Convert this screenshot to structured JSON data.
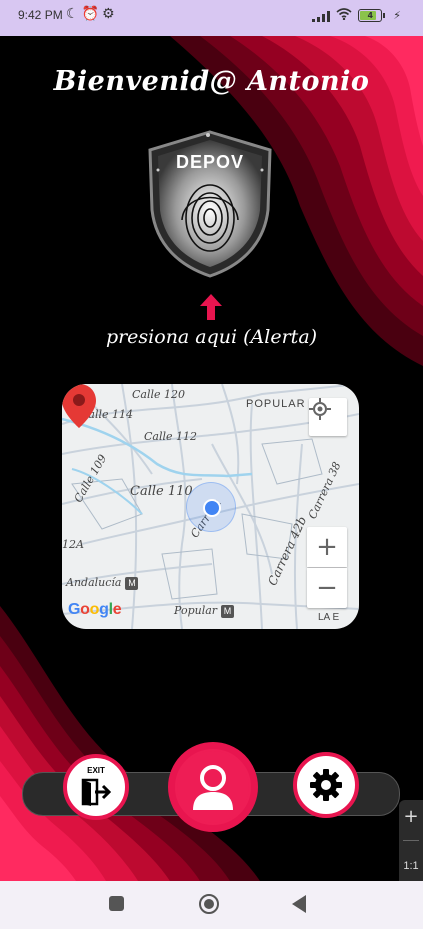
{
  "status_bar": {
    "time": "9:42 PM",
    "left_icons": [
      "moon-icon",
      "alarm-icon",
      "settings-gear-icon"
    ],
    "battery_level": "4",
    "battery_fill_fraction": 0.7,
    "right_icons": [
      "signal-icon",
      "wifi-icon",
      "battery-icon",
      "charging-bolt-icon"
    ]
  },
  "header": {
    "welcome_text": "Bienvenid@ Antonio"
  },
  "alert": {
    "shield_title": "DEPOV",
    "shield_icon": "fingerprint-shield-icon",
    "arrow_icon": "arrow-up-icon",
    "instruction_text": "presiona aqui (Alerta)"
  },
  "map": {
    "street_labels": [
      "Calle 120",
      "Calle 114",
      "Calle 112",
      "Calle 109",
      "Calle 110",
      "Carrera",
      "Carrera 42b",
      "Carrera 38",
      "POPULAR",
      "12A",
      "Andalucía",
      "Popular",
      "LA E"
    ],
    "metro_badge": "M",
    "attribution": "Google",
    "zoom_in_label": "+",
    "zoom_out_label": "−",
    "controls": [
      "my-location-icon",
      "zoom-in-button",
      "zoom-out-button"
    ],
    "colors": {
      "pin": "#e53935",
      "my_location": "#4285f4"
    }
  },
  "bottom_nav": {
    "exit_label": "EXIT",
    "exit_icon": "exit-door-icon",
    "profile_icon": "user-profile-icon",
    "settings_icon": "gear-icon"
  },
  "side_toolbar": {
    "plus_label": "+",
    "ratio_label": "1:1"
  },
  "system_nav": {
    "icons": [
      "recent-apps-icon",
      "home-icon",
      "back-icon"
    ]
  },
  "colors": {
    "accent": "#e8154f",
    "background": "#000000",
    "status_bar": "#d8c7f2"
  }
}
